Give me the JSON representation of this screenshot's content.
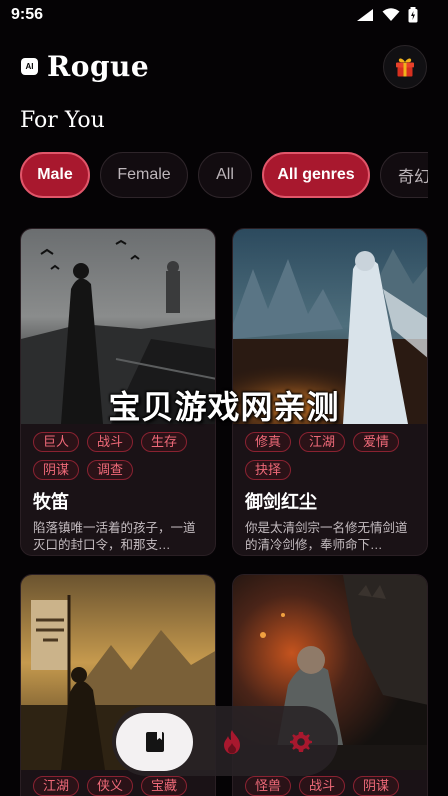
{
  "status": {
    "time": "9:56"
  },
  "app": {
    "logo_text": "AI",
    "title": "Rogue"
  },
  "section_title": "For You",
  "filters": [
    {
      "label": "Male",
      "active": true
    },
    {
      "label": "Female",
      "active": false
    },
    {
      "label": "All",
      "active": false
    },
    {
      "label": "All genres",
      "active": true
    },
    {
      "label": "奇幻",
      "active": false
    }
  ],
  "watermark": "宝贝游戏网亲测",
  "cards": [
    {
      "tags": [
        "巨人",
        "战斗",
        "生存",
        "阴谋",
        "调查"
      ],
      "title": "牧笛",
      "description": "陷落镇唯一活着的孩子，一道灭口的封口令，和那支…"
    },
    {
      "tags": [
        "修真",
        "江湖",
        "爱情",
        "抉择"
      ],
      "title": "御剑红尘",
      "description": "你是太清剑宗一名修无情剑道的清冷剑修，奉师命下…"
    },
    {
      "tags": [
        "江湖",
        "侠义",
        "宝藏"
      ],
      "title": "",
      "description": ""
    },
    {
      "tags": [
        "怪兽",
        "战斗",
        "阴谋"
      ],
      "title": "",
      "description": ""
    }
  ],
  "nav": {
    "items": [
      "library-icon",
      "flame-icon",
      "settings-icon"
    ]
  },
  "colors": {
    "accent": "#a8182e",
    "tag_text": "#f06a79",
    "background": "#050305"
  }
}
